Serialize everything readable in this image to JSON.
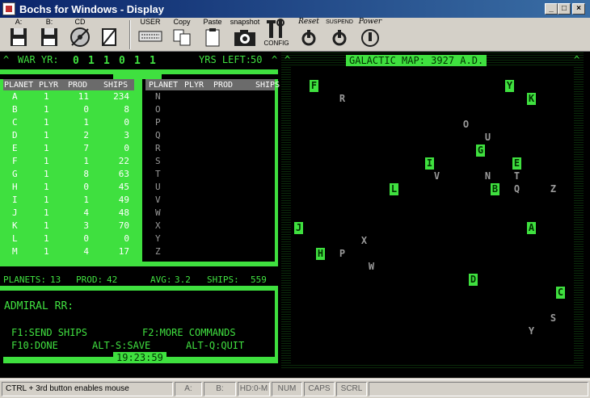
{
  "window": {
    "title": "Bochs for Windows - Display",
    "minimize": "_",
    "maximize": "□",
    "close": "×"
  },
  "toolbar": {
    "floppy_a": "A:",
    "floppy_b": "B:",
    "cdrom": "CD",
    "user": "USER",
    "copy": "Copy",
    "paste": "Paste",
    "snapshot": "snapshot",
    "config": "CONFIG",
    "reset": "Reset",
    "suspend": "SUSPEND",
    "power": "Power"
  },
  "game": {
    "war_yr_label": "WAR YR:",
    "war_yr_digits": [
      "0",
      "1",
      "1",
      "0",
      "1",
      "1"
    ],
    "yrs_left_label": "YRS LEFT:",
    "yrs_left": "50",
    "map_title": "GALACTIC MAP: 3927 A.D.",
    "columns": {
      "planet": "PLANET",
      "plyr": "PLYR",
      "prod": "PROD",
      "ships": "SHIPS"
    },
    "left_rows": [
      {
        "planet": "A",
        "plyr": "1",
        "prod": "11",
        "ships": "234"
      },
      {
        "planet": "B",
        "plyr": "1",
        "prod": "0",
        "ships": "8"
      },
      {
        "planet": "C",
        "plyr": "1",
        "prod": "1",
        "ships": "0"
      },
      {
        "planet": "D",
        "plyr": "1",
        "prod": "2",
        "ships": "3"
      },
      {
        "planet": "E",
        "plyr": "1",
        "prod": "7",
        "ships": "0"
      },
      {
        "planet": "F",
        "plyr": "1",
        "prod": "1",
        "ships": "22"
      },
      {
        "planet": "G",
        "plyr": "1",
        "prod": "8",
        "ships": "63"
      },
      {
        "planet": "H",
        "plyr": "1",
        "prod": "0",
        "ships": "45"
      },
      {
        "planet": "I",
        "plyr": "1",
        "prod": "1",
        "ships": "49"
      },
      {
        "planet": "J",
        "plyr": "1",
        "prod": "4",
        "ships": "48"
      },
      {
        "planet": "K",
        "plyr": "1",
        "prod": "3",
        "ships": "70"
      },
      {
        "planet": "L",
        "plyr": "1",
        "prod": "0",
        "ships": "0"
      },
      {
        "planet": "M",
        "plyr": "1",
        "prod": "4",
        "ships": "17"
      }
    ],
    "right_rows": [
      "N",
      "O",
      "P",
      "Q",
      "R",
      "S",
      "T",
      "U",
      "V",
      "W",
      "X",
      "Y",
      "Z"
    ],
    "totals": {
      "planets_label": "PLANETS:",
      "planets": "13",
      "prod_label": "PROD:",
      "prod": "42",
      "avg_label": "AVG:",
      "avg": "3.2",
      "ships_label": "SHIPS:",
      "ships": "559"
    },
    "prompt": "ADMIRAL RR:",
    "keys": {
      "f1": "F1:SEND SHIPS",
      "f2": "F2:MORE COMMANDS",
      "f10": "F10:DONE",
      "alt_s": "ALT-S:SAVE",
      "alt_q": "ALT-Q:QUIT"
    },
    "clock": "19:23:59",
    "owned_planets": [
      "F",
      "Y",
      "K",
      "G",
      "I",
      "E",
      "L",
      "B",
      "A",
      "J",
      "H",
      "D",
      "C"
    ],
    "neutral_planets": [
      "R",
      "O",
      "U",
      "V",
      "N",
      "T",
      "Q",
      "Z",
      "X",
      "P",
      "W",
      "S"
    ]
  },
  "status": {
    "message": "CTRL + 3rd button enables mouse",
    "a": "A:",
    "b": "B:",
    "hd": "HD:0-M",
    "num": "NUM",
    "caps": "CAPS",
    "scrl": "SCRL"
  },
  "colors": {
    "green": "#3fe03f",
    "titlebar": "#0a246a",
    "neutral": "#9a9a9a"
  }
}
